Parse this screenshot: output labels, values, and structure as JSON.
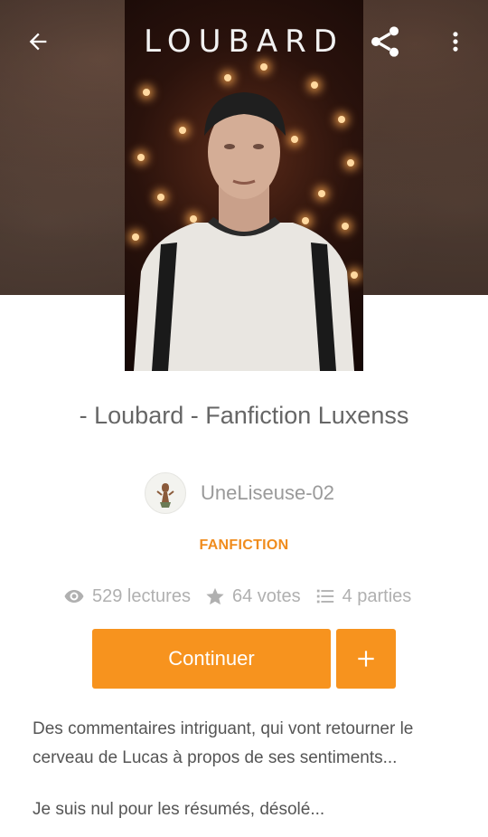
{
  "cover": {
    "title": "LOUBARD"
  },
  "toolbar": {
    "back_icon": "arrow-left-icon",
    "share_icon": "share-icon",
    "menu_icon": "more-vertical-icon"
  },
  "story": {
    "title": "- Loubard - Fanfiction Luxenss",
    "author": "UneLiseuse-02",
    "category": "FANFICTION",
    "stats": {
      "reads": "529 lectures",
      "votes": "64 votes",
      "parts": "4 parties"
    },
    "description": [
      "Des commentaires intriguant, qui vont retourner le cerveau de Lucas à propos de ses sentiments...",
      "Je suis nul pour les résumés, désolé..."
    ]
  },
  "actions": {
    "continue_label": "Continuer",
    "add_label": "+"
  },
  "colors": {
    "accent": "#f7931e",
    "category": "#f08c1d",
    "text_muted": "#b0b0b0"
  }
}
